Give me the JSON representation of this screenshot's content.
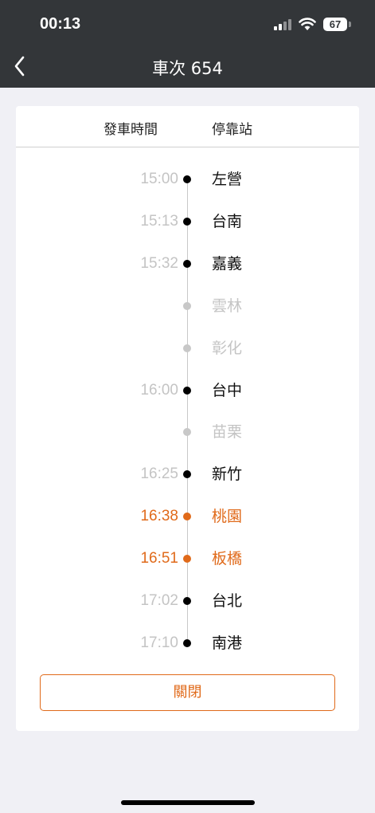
{
  "status_bar": {
    "time": "00:13",
    "battery": "67"
  },
  "header": {
    "title": "車次 654"
  },
  "table": {
    "col_time": "發車時間",
    "col_station": "停靠站",
    "stops": [
      {
        "time": "15:00",
        "station": "左營",
        "state": "stop"
      },
      {
        "time": "15:13",
        "station": "台南",
        "state": "stop"
      },
      {
        "time": "15:32",
        "station": "嘉義",
        "state": "stop"
      },
      {
        "time": "",
        "station": "雲林",
        "state": "pass"
      },
      {
        "time": "",
        "station": "彰化",
        "state": "pass"
      },
      {
        "time": "16:00",
        "station": "台中",
        "state": "stop"
      },
      {
        "time": "",
        "station": "苗栗",
        "state": "pass"
      },
      {
        "time": "16:25",
        "station": "新竹",
        "state": "stop"
      },
      {
        "time": "16:38",
        "station": "桃園",
        "state": "highlight"
      },
      {
        "time": "16:51",
        "station": "板橋",
        "state": "highlight"
      },
      {
        "time": "17:02",
        "station": "台北",
        "state": "stop"
      },
      {
        "time": "17:10",
        "station": "南港",
        "state": "stop"
      }
    ]
  },
  "close_label": "關閉",
  "colors": {
    "accent": "#e06a1a",
    "header_bg": "#333639",
    "muted": "#c4c4c4"
  },
  "icons": {
    "back": "chevron-left-icon",
    "wifi": "wifi-icon",
    "signal": "cellular-signal-icon",
    "battery": "battery-icon"
  }
}
